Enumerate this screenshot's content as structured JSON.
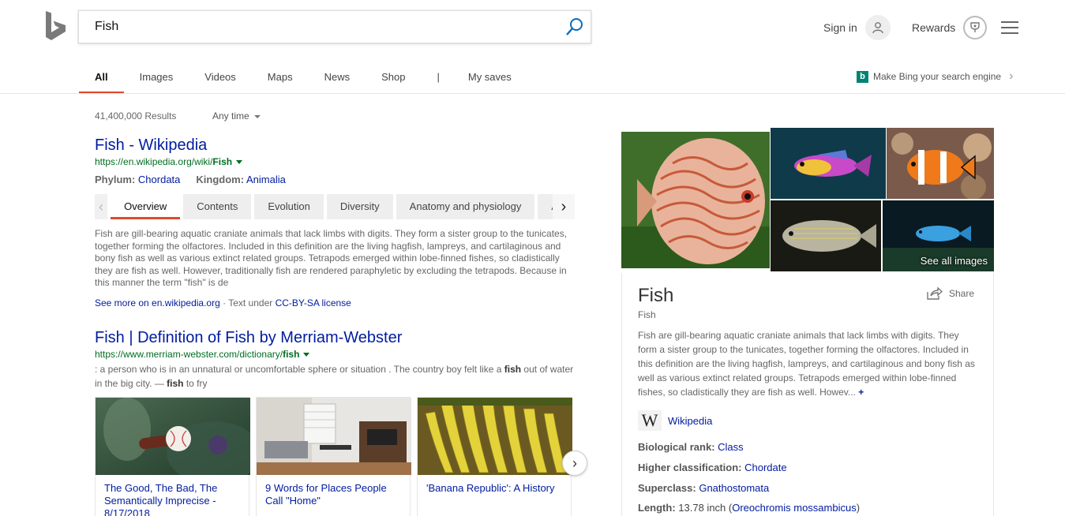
{
  "header": {
    "search_value": "Fish",
    "signin_label": "Sign in",
    "rewards_label": "Rewards"
  },
  "tabs": [
    "All",
    "Images",
    "Videos",
    "Maps",
    "News",
    "Shop",
    "|",
    "My saves"
  ],
  "promo": {
    "label": "Make Bing your search engine"
  },
  "meta": {
    "result_count": "41,400,000 Results",
    "time_filter": "Any time"
  },
  "results": [
    {
      "title": "Fish - Wikipedia",
      "url_prefix": "https://en.wikipedia.org/wiki/",
      "url_bold": "Fish",
      "facts": [
        {
          "label": "Phylum:",
          "value": "Chordata"
        },
        {
          "label": "Kingdom:",
          "value": "Animalia"
        }
      ],
      "subtabs": [
        "Overview",
        "Contents",
        "Evolution",
        "Diversity",
        "Anatomy and physiology",
        "A"
      ],
      "snippet": "Fish are gill-bearing aquatic craniate animals that lack limbs with digits. They form a sister group to the tunicates, together forming the olfactores. Included in this definition are the living hagfish, lampreys, and cartilaginous and bony fish as well as various extinct related groups. Tetrapods emerged within lobe-finned fishes, so cladistically they are fish as well. However, traditionally fish are rendered paraphyletic by excluding the tetrapods. Because in this manner the term \"fish\" is de",
      "seemore_link": "See more on en.wikipedia.org",
      "seemore_mid": " · Text under ",
      "license": "CC-BY-SA license"
    },
    {
      "title": "Fish | Definition of Fish by Merriam-Webster",
      "url_prefix": "https://www.merriam-webster.com/dictionary/",
      "url_bold": "fish",
      "snippet_a": ": a person who is in an unnatural or uncomfortable sphere or situation . The country boy felt like a ",
      "snippet_b1": "fish",
      "snippet_c": " out of water in the big city. — ",
      "snippet_b2": "fish",
      "snippet_d": " to fry",
      "cards": [
        {
          "caption": "The Good, The Bad, The Semantically Imprecise - 8/17/2018"
        },
        {
          "caption": "9 Words for Places People Call \"Home\""
        },
        {
          "caption": "'Banana Republic': A History"
        }
      ]
    }
  ],
  "knowledge_panel": {
    "title": "Fish",
    "subtitle": "Fish",
    "share_label": "Share",
    "see_all_images": "See all images",
    "description": "Fish are gill-bearing aquatic craniate animals that lack limbs with digits. They form a sister group to the tunicates, together forming the olfactores. Included in this definition are the living hagfish, lampreys, and cartilaginous and bony fish as well as various extinct related groups. Tetrapods emerged within lobe-finned fishes, so cladistically they are fish as well. Howev...",
    "more": "+",
    "source": "Wikipedia",
    "facts": [
      {
        "label": "Biological rank:",
        "value": "Class",
        "extra": ""
      },
      {
        "label": "Higher classification:",
        "value": "Chordate",
        "extra": ""
      },
      {
        "label": "Superclass:",
        "value": "Gnathostomata",
        "extra": ""
      },
      {
        "label": "Length:",
        "value": "13.78 inch (",
        "link": "Oreochromis mossambicus",
        "extra": ")"
      }
    ]
  }
}
